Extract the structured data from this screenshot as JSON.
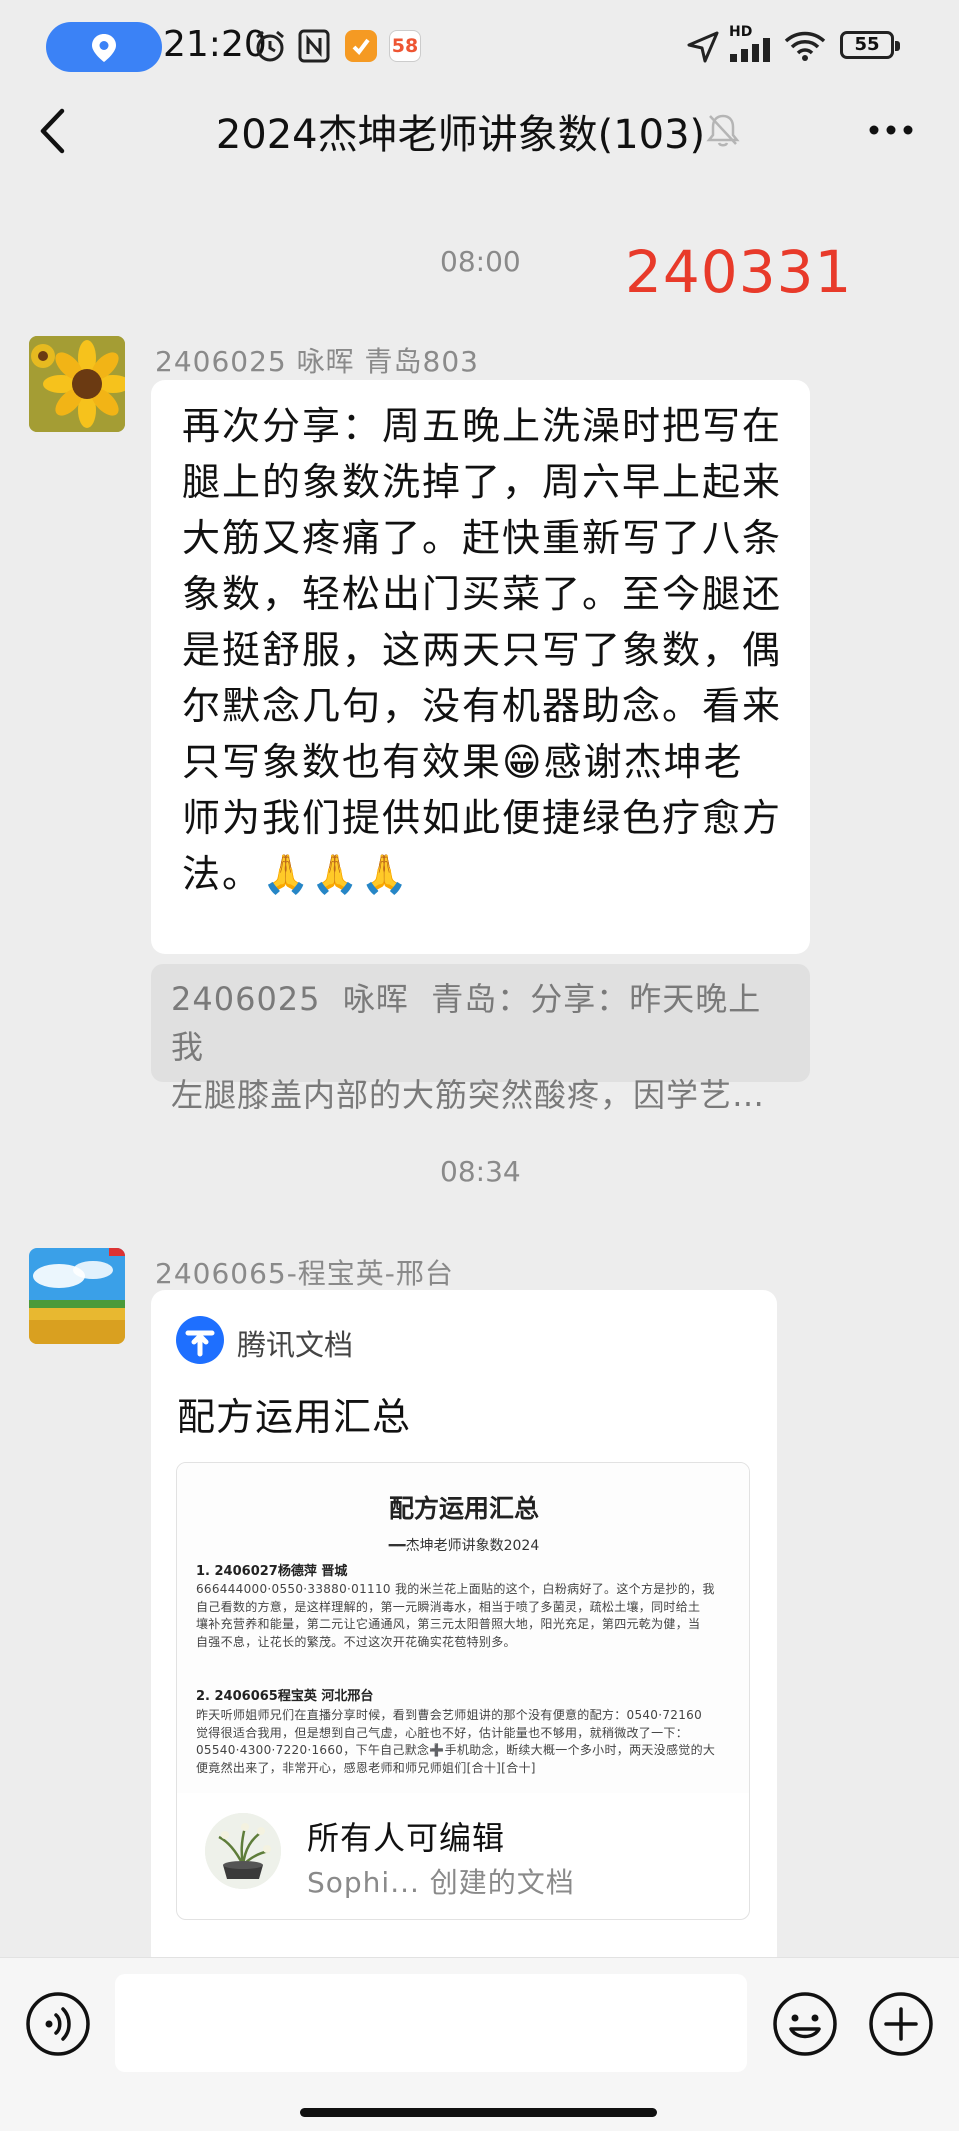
{
  "status_bar": {
    "time": "21:20",
    "badge_58": "58",
    "battery": "55",
    "hd_label": "HD"
  },
  "header": {
    "title": "2024杰坤老师讲象数(103)"
  },
  "messages": {
    "time_1": "08:00",
    "red_stamp": "240331",
    "msg1": {
      "sender": "2406025  咏晖  青岛803",
      "text": "再次分享：周五晚上洗澡时把写在\n腿上的象数洗掉了，周六早上起来\n大筋又疼痛了。赶快重新写了八条\n象数，轻松出门买菜了。至今腿还\n是挺舒服，这两天只写了象数，偶\n尔默念几句，没有机器助念。看来\n只写象数也有效果😁感谢杰坤老\n师为我们提供如此便捷绿色疗愈方\n法。🙏🙏🙏",
      "quote": "2406025  咏晖  青岛：分享：昨天晚上我\n左腿膝盖内部的大筋突然酸疼，因学艺…"
    },
    "time_2": "08:34",
    "msg2": {
      "sender": "2406065-程宝英-邢台",
      "doc_brand": "腾讯文档",
      "doc_title": "配方运用汇总",
      "preview": {
        "title": "配方运用汇总",
        "subtitle": "━━杰坤老师讲象数2024",
        "section1_heading": "1. 2406027杨德萍 晋城",
        "section1_lines": [
          "666444000·0550·33880·01110   我的米兰花上面贴的这个，白粉病好了。这个方是抄的，我",
          "自己看数的方意，是这样理解的，第一元瞬消毒水，相当于喷了多菌灵，疏松土壤，同时给土",
          "壤补充营养和能量，第二元让它通通风，第三元太阳普照大地，阳光充足，第四元乾为健，当",
          "自强不息，让花长的繁茂。不过这次开花确实花苞特别多。"
        ],
        "section2_heading": "2. 2406065程宝英 河北邢台",
        "section2_lines": [
          "昨天听师姐师兄们在直播分享时候，看到曹会艺师姐讲的那个没有便意的配方：0540·72160",
          "觉得很适合我用，但是想到自己气虚，心脏也不好，估计能量也不够用，就稍微改了一下：",
          "05540·4300·7220·1660，下午自己默念➕手机助念，断续大概一个多小时，两天没感觉的大",
          "便竟然出来了，非常开心，感恩老师和师兄师姐们[合十][合十]"
        ]
      },
      "editable": "所有人可编辑",
      "creator": "Sophi... 创建的文档"
    }
  },
  "colors": {
    "background": "#ededed",
    "accent_red": "#e83a2a",
    "location_pill": "#3b82f6",
    "tencent_docs_blue": "#1e6fff"
  }
}
